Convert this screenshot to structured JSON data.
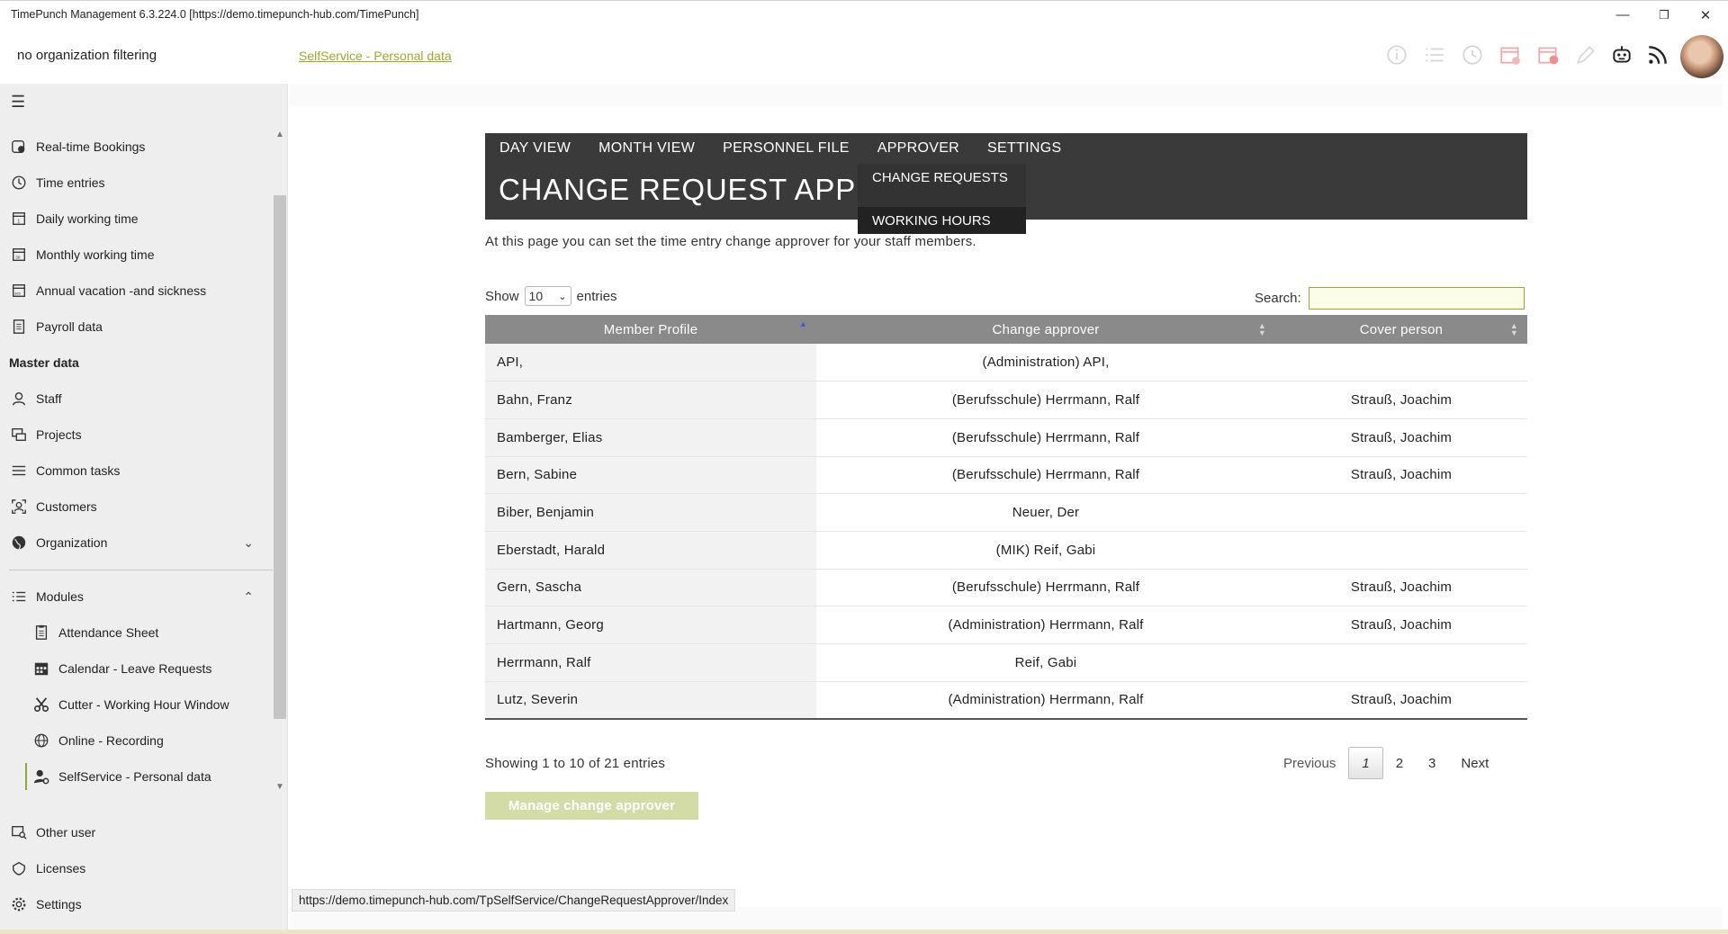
{
  "window": {
    "title": "TimePunch Management 6.3.224.0 [https://demo.timepunch-hub.com/TimePunch]",
    "minimize": "—",
    "restore": "❐",
    "close": "✕"
  },
  "header": {
    "org_filter": "no organization filtering",
    "link": "SelfService - Personal data",
    "icons": [
      "info-icon",
      "list-icon",
      "history-icon",
      "calendar-icon",
      "calendar-alert-icon",
      "pencil-icon",
      "robot-icon",
      "rss-icon"
    ]
  },
  "sidebar": {
    "menu_icon": "☰",
    "items_top": [
      {
        "label": "Real-time Bookings",
        "icon": "clock-badge-icon"
      },
      {
        "label": "Time entries",
        "icon": "clock-icon"
      },
      {
        "label": "Daily working time",
        "icon": "calendar-day-icon"
      },
      {
        "label": "Monthly working time",
        "icon": "calendar-month-icon"
      },
      {
        "label": "Annual vacation -and sickness",
        "icon": "calendar-year-icon"
      },
      {
        "label": "Payroll data",
        "icon": "payroll-icon"
      }
    ],
    "master_data_heading": "Master data",
    "items_master": [
      {
        "label": "Staff",
        "icon": "person-icon"
      },
      {
        "label": "Projects",
        "icon": "projects-icon"
      },
      {
        "label": "Common tasks",
        "icon": "tasks-icon"
      },
      {
        "label": "Customers",
        "icon": "customers-icon"
      },
      {
        "label": "Organization",
        "icon": "globe-icon"
      }
    ],
    "modules_label": "Modules",
    "modules": [
      {
        "label": "Attendance Sheet",
        "icon": "attendance-icon"
      },
      {
        "label": "Calendar - Leave Requests",
        "icon": "calendar-leave-icon"
      },
      {
        "label": "Cutter - Working Hour Window",
        "icon": "scissors-icon"
      },
      {
        "label": "Online - Recording",
        "icon": "web-icon"
      },
      {
        "label": "SelfService - Personal data",
        "icon": "person-gear-icon"
      }
    ],
    "items_bottom": [
      {
        "label": "Other user",
        "icon": "other-user-icon"
      },
      {
        "label": "Licenses",
        "icon": "license-icon"
      },
      {
        "label": "Settings",
        "icon": "gear-icon"
      }
    ]
  },
  "main": {
    "topnav": [
      "DAY VIEW",
      "MONTH VIEW",
      "PERSONNEL FILE",
      "APPROVER",
      "SETTINGS"
    ],
    "page_title": "CHANGE REQUEST APPROVER",
    "dropdown": [
      "CHANGE REQUESTS",
      "WORKING HOURS"
    ],
    "intro": "At this page you can set the time entry change approver for your staff members.",
    "show_label": "Show",
    "show_value": "10",
    "entries_label": "entries",
    "search_label": "Search:",
    "search_value": "",
    "columns": [
      "Member Profile",
      "Change approver",
      "Cover person"
    ],
    "rows": [
      {
        "member": "API,",
        "approver": "(Administration) API,",
        "cover": ""
      },
      {
        "member": "Bahn, Franz",
        "approver": "(Berufsschule) Herrmann, Ralf",
        "cover": "Strauß, Joachim"
      },
      {
        "member": "Bamberger, Elias",
        "approver": "(Berufsschule) Herrmann, Ralf",
        "cover": "Strauß, Joachim"
      },
      {
        "member": "Bern, Sabine",
        "approver": "(Berufsschule) Herrmann, Ralf",
        "cover": "Strauß, Joachim"
      },
      {
        "member": "Biber, Benjamin",
        "approver": "Neuer, Der",
        "cover": ""
      },
      {
        "member": "Eberstadt, Harald",
        "approver": "(MIK) Reif, Gabi",
        "cover": ""
      },
      {
        "member": "Gern, Sascha",
        "approver": "(Berufsschule) Herrmann, Ralf",
        "cover": "Strauß, Joachim"
      },
      {
        "member": "Hartmann, Georg",
        "approver": "(Administration) Herrmann, Ralf",
        "cover": "Strauß, Joachim"
      },
      {
        "member": "Herrmann, Ralf",
        "approver": "Reif, Gabi",
        "cover": ""
      },
      {
        "member": "Lutz, Severin",
        "approver": "(Administration) Herrmann, Ralf",
        "cover": "Strauß, Joachim"
      }
    ],
    "info": "Showing 1 to 10 of 21 entries",
    "pager": {
      "previous": "Previous",
      "pages": [
        "1",
        "2",
        "3"
      ],
      "current": "1",
      "next": "Next"
    },
    "manage_button": "Manage change approver"
  },
  "status_url": "https://demo.timepunch-hub.com/TpSelfService/ChangeRequestApprover/Index",
  "colors": {
    "accent": "#9ea82c",
    "banner": "#3a3a3a",
    "table_header": "#8a8a8a",
    "button_disabled": "#d3dba7"
  }
}
